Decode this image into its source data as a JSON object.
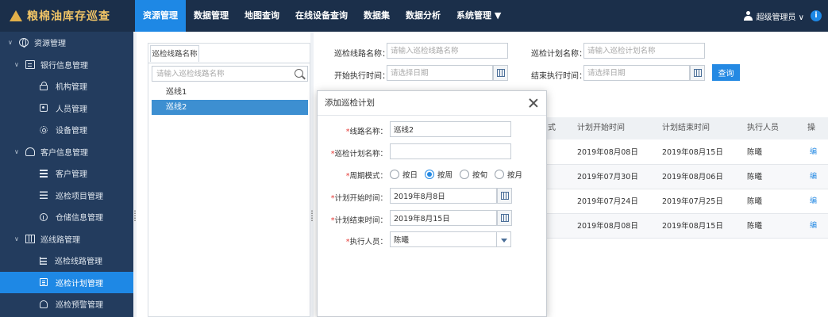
{
  "app": {
    "title": "粮棉油库存巡查"
  },
  "nav": {
    "items": [
      {
        "label": "资源管理"
      },
      {
        "label": "数据管理"
      },
      {
        "label": "地图查询"
      },
      {
        "label": "在线设备查询"
      },
      {
        "label": "数据集"
      },
      {
        "label": "数据分析"
      },
      {
        "label": "系统管理 ▼"
      }
    ],
    "user_label": "超级管理员 ∨",
    "info_icon": "i"
  },
  "sidebar": {
    "items": [
      {
        "label": "资源管理",
        "icon": "globe-icon"
      },
      {
        "label": "银行信息管理",
        "icon": "card-icon"
      },
      {
        "label": "机构管理",
        "icon": "lock-icon"
      },
      {
        "label": "人员管理",
        "icon": "person-icon"
      },
      {
        "label": "设备管理",
        "icon": "gear-icon"
      },
      {
        "label": "客户信息管理",
        "icon": "people-icon"
      },
      {
        "label": "客户管理",
        "icon": "grid-icon"
      },
      {
        "label": "巡检项目管理",
        "icon": "lines-icon"
      },
      {
        "label": "仓储信息管理",
        "icon": "info-icon"
      },
      {
        "label": "巡线路管理",
        "icon": "map-icon"
      },
      {
        "label": "巡检线路管理",
        "icon": "list-icon"
      },
      {
        "label": "巡检计划管理",
        "icon": "doc-icon"
      },
      {
        "label": "巡检预警管理",
        "icon": "alarm-icon"
      }
    ],
    "chevron": "∨"
  },
  "tree": {
    "tab_label": "巡检线路名称",
    "search_placeholder": "请输入巡检线路名称",
    "items": [
      {
        "label": "巡线1"
      },
      {
        "label": "巡线2"
      }
    ]
  },
  "filters": {
    "route_name_label": "巡检线路名称：",
    "route_name_placeholder": "请输入巡检线路名称",
    "plan_name_label": "巡检计划名称：",
    "plan_name_placeholder": "请输入巡检计划名称",
    "start_time_label": "开始执行时间：",
    "start_time_placeholder": "请选择日期",
    "end_time_label": "结束执行时间：",
    "end_time_placeholder": "请选择日期",
    "query_label": "查询"
  },
  "table": {
    "headers": [
      "式",
      "计划开始时间",
      "计划结束时间",
      "执行人员",
      "操"
    ],
    "rows": [
      {
        "start": "2019年08月08日",
        "end": "2019年08月15日",
        "person": "陈曦",
        "op": "编"
      },
      {
        "start": "2019年07月30日",
        "end": "2019年08月06日",
        "person": "陈曦",
        "op": "编"
      },
      {
        "start": "2019年07月24日",
        "end": "2019年07月25日",
        "person": "陈曦",
        "op": "编"
      },
      {
        "start": "2019年08月08日",
        "end": "2019年08月15日",
        "person": "陈曦",
        "op": "编"
      }
    ]
  },
  "modal": {
    "title": "添加巡检计划",
    "required_mark": "*",
    "route_label": "线路名称：",
    "route_value": "巡线2",
    "plan_label": "巡检计划名称：",
    "plan_value": "",
    "cycle_label": "周期模式：",
    "cycle_options": [
      {
        "label": "按日",
        "selected": false
      },
      {
        "label": "按周",
        "selected": true
      },
      {
        "label": "按旬",
        "selected": false
      },
      {
        "label": "按月",
        "selected": false
      }
    ],
    "start_label": "计划开始时间：",
    "start_value": "2019年8月8日",
    "end_label": "计划结束时间：",
    "end_value": "2019年8月15日",
    "executor_label": "执行人员：",
    "executor_value": "陈曦"
  },
  "colors": {
    "topbar": "#1b2f4a",
    "sidebar": "#233c5e",
    "accent": "#1e88e5",
    "logo": "#f0c466"
  }
}
